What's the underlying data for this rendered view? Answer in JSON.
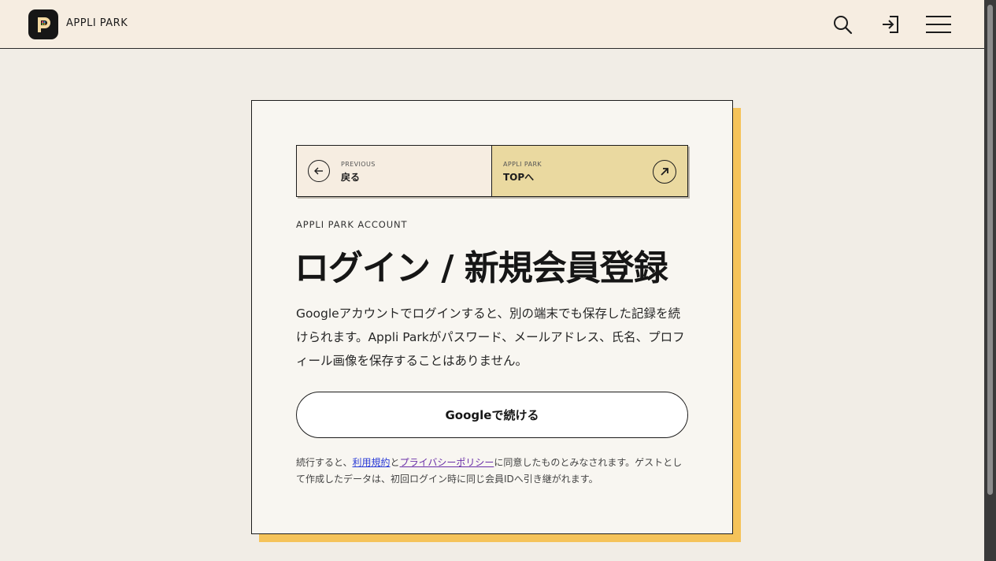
{
  "header": {
    "brand": "APPLI PARK"
  },
  "nav": {
    "prev_small": "PREVIOUS",
    "prev_label": "戻る",
    "top_small": "APPLI PARK",
    "top_label": "TOPへ"
  },
  "card": {
    "kicker": "APPLI PARK ACCOUNT",
    "title": "ログイン / 新規会員登録",
    "description": "Googleアカウントでログインすると、別の端末でも保存した記録を続けられます。Appli Parkがパスワード、メールアドレス、氏名、プロフィール画像を保存することはありません。",
    "google_button": "Googleで続ける",
    "note_prefix": "続行すると、",
    "terms_link": "利用規約",
    "note_and": "と",
    "privacy_link": "プライバシーポリシー",
    "note_suffix": "に同意したものとみなされます。ゲストとして作成したデータは、初回ログイン時に同じ会員IDへ引き継がれます。"
  },
  "colors": {
    "page_bg": "#f1ede6",
    "header_bg": "#f6ede1",
    "card_bg": "#f8f6f1",
    "card_shadow": "#f5c35a",
    "nav_top_bg": "#ead9a0",
    "link": "#2a3bd6"
  },
  "icons": {
    "logo": "appli-park-logo-icon",
    "search": "search-icon",
    "login": "login-icon",
    "menu": "hamburger-menu-icon",
    "back": "arrow-left-icon",
    "external": "arrow-up-right-icon"
  }
}
